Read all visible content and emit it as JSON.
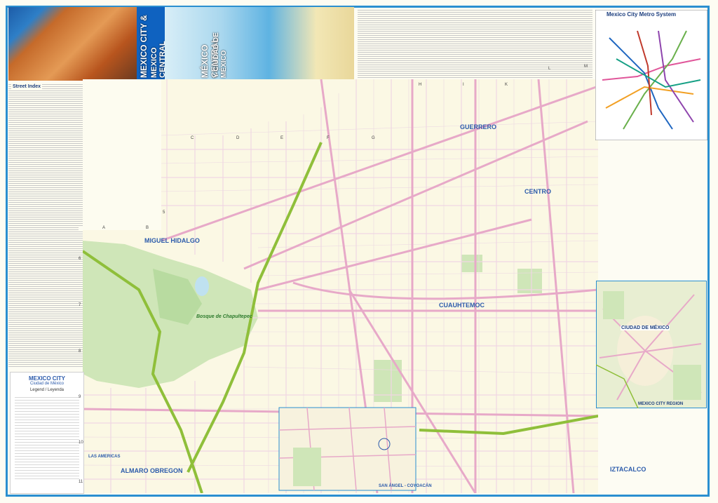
{
  "cover": {
    "title_en_line1": "MEXICO CITY &",
    "title_en_line2": "MEXICO CENTRAL",
    "title_es_line1": "MÉXICO CENTRAL",
    "title_es_line2": "Y CIUDAD DE MÉXICO"
  },
  "index_title": "Street Index",
  "metro": {
    "title": "Mexico City Metro System"
  },
  "legend": {
    "title": "MEXICO CITY",
    "subtitle": "Ciudad de México",
    "heading": "Legend / Leyenda"
  },
  "inset": {
    "label": "CIUDAD DE MÉXICO",
    "caption": "MEXICO CITY REGION"
  },
  "districts": [
    {
      "name": "GUERRERO"
    },
    {
      "name": "CENTRO"
    },
    {
      "name": "MIGUEL HIDALGO"
    },
    {
      "name": "CUAUHTEMOC"
    },
    {
      "name": "ALMARO OBREGON"
    },
    {
      "name": "IZTACALCO"
    },
    {
      "name": "LAS AMERICAS"
    },
    {
      "name": "SAN ÁNGEL - COYOACÁN"
    }
  ],
  "park": {
    "name": "Bosque de Chapultepec"
  },
  "grid": {
    "top": [
      "C",
      "D",
      "E",
      "F",
      "G",
      "H",
      "I",
      "K",
      "L",
      "M"
    ],
    "left": [
      "A",
      "B"
    ],
    "rows": [
      "5",
      "6",
      "7",
      "8",
      "9",
      "10",
      "11"
    ]
  },
  "colors": {
    "border": "#2a8fd0",
    "road_major": "#e7a9c8",
    "road_minor": "#f2cfe0",
    "highway": "#8fbf3a",
    "water": "#bfe1f0",
    "park": "#cfe6b8"
  }
}
